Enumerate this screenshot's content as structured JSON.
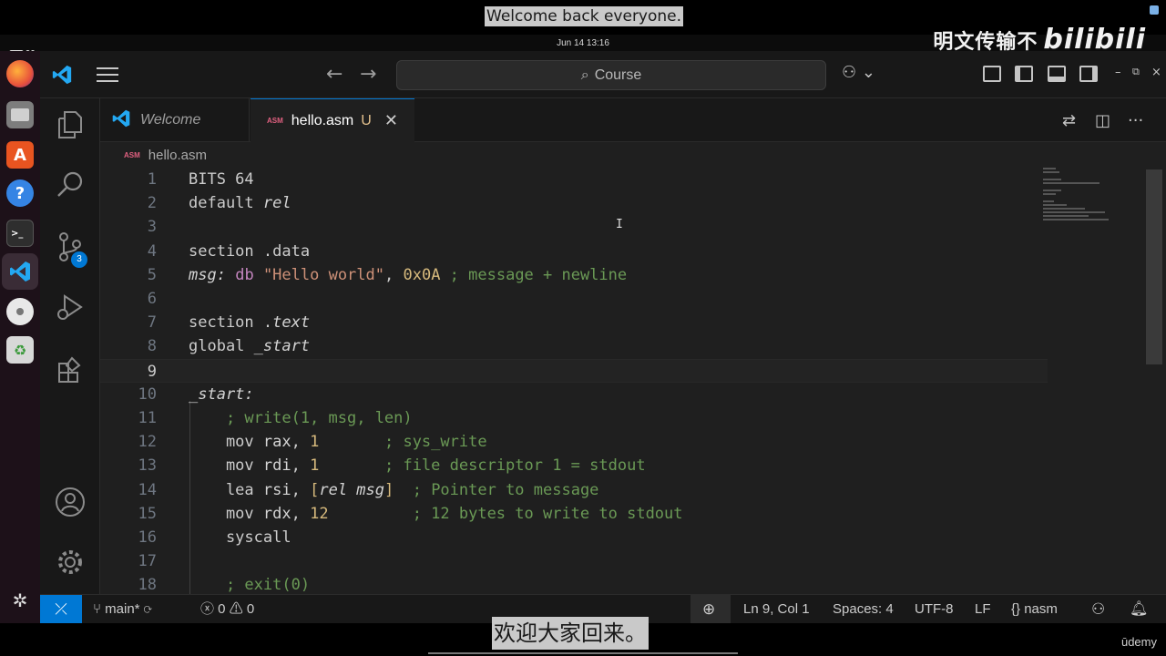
{
  "captions": {
    "top": "Welcome back everyone.",
    "bottom": "欢迎大家回来。"
  },
  "watermark": {
    "text": "明文传输不",
    "logo": "bilibili"
  },
  "system": {
    "clock": "Jun 14  13:16"
  },
  "dock": {
    "items": [
      "firefox-icon",
      "files-icon",
      "app-center-icon",
      "help-icon",
      "terminal-icon",
      "vscode-icon",
      "disc-icon",
      "trash-icon",
      "ubuntu-icon"
    ]
  },
  "titlebar": {
    "search_label": "Course",
    "search_icon": "search-icon"
  },
  "activitybar": {
    "scm_badge": "3"
  },
  "tabs": [
    {
      "label": "Welcome",
      "active": false
    },
    {
      "label": "hello.asm",
      "active": true,
      "status": "U",
      "icon": "ASM"
    }
  ],
  "breadcrumb": {
    "file": "hello.asm",
    "icon": "ASM"
  },
  "editor": {
    "line_numbers": [
      "1",
      "2",
      "3",
      "4",
      "5",
      "6",
      "7",
      "8",
      "9",
      "10",
      "11",
      "12",
      "13",
      "14",
      "15",
      "16",
      "17",
      "18"
    ],
    "current_line": 9,
    "lines": [
      [
        {
          "t": "BITS 64",
          "c": "kw"
        }
      ],
      [
        {
          "t": "default ",
          "c": "kw"
        },
        {
          "t": "rel",
          "c": "it"
        }
      ],
      [],
      [
        {
          "t": "section .data",
          "c": "kw"
        }
      ],
      [
        {
          "t": "msg:",
          "c": "it"
        },
        {
          "t": " ",
          "c": "kw"
        },
        {
          "t": "db",
          "c": "op"
        },
        {
          "t": " ",
          "c": "kw"
        },
        {
          "t": "\"Hello world\"",
          "c": "str"
        },
        {
          "t": ", ",
          "c": "kw"
        },
        {
          "t": "0x0A",
          "c": "num"
        },
        {
          "t": " ; message + newline",
          "c": "cm"
        }
      ],
      [],
      [
        {
          "t": "section .",
          "c": "kw"
        },
        {
          "t": "text",
          "c": "it"
        }
      ],
      [
        {
          "t": "global ",
          "c": "kw"
        },
        {
          "t": "_start",
          "c": "it"
        }
      ],
      [],
      [
        {
          "t": "_start:",
          "c": "it"
        }
      ],
      [
        {
          "t": "    ; write(1, msg, len)",
          "c": "cm"
        }
      ],
      [
        {
          "t": "    mov ",
          "c": "kw"
        },
        {
          "t": "rax",
          "c": "reg"
        },
        {
          "t": ", ",
          "c": "kw"
        },
        {
          "t": "1",
          "c": "num"
        },
        {
          "t": "       ; sys_write",
          "c": "cm"
        }
      ],
      [
        {
          "t": "    mov ",
          "c": "kw"
        },
        {
          "t": "rdi",
          "c": "reg"
        },
        {
          "t": ", ",
          "c": "kw"
        },
        {
          "t": "1",
          "c": "num"
        },
        {
          "t": "       ; file descriptor 1 = stdout",
          "c": "cm"
        }
      ],
      [
        {
          "t": "    lea ",
          "c": "kw"
        },
        {
          "t": "rsi",
          "c": "reg"
        },
        {
          "t": ", ",
          "c": "kw"
        },
        {
          "t": "[",
          "c": "br"
        },
        {
          "t": "rel msg",
          "c": "it"
        },
        {
          "t": "]",
          "c": "br"
        },
        {
          "t": "  ; Pointer to message",
          "c": "cm"
        }
      ],
      [
        {
          "t": "    mov ",
          "c": "kw"
        },
        {
          "t": "rdx",
          "c": "reg"
        },
        {
          "t": ", ",
          "c": "kw"
        },
        {
          "t": "12",
          "c": "num"
        },
        {
          "t": "         ; 12 bytes to write to stdout",
          "c": "cm"
        }
      ],
      [
        {
          "t": "    syscall",
          "c": "kw"
        }
      ],
      [],
      [
        {
          "t": "    ; exit(0)",
          "c": "cm"
        }
      ]
    ]
  },
  "statusbar": {
    "branch": "main*",
    "errors": "0",
    "warnings": "0",
    "position": "Ln 9, Col 1",
    "spaces": "Spaces: 4",
    "encoding": "UTF-8",
    "eol": "LF",
    "language": "nasm"
  },
  "branding": {
    "udemy": "ūdemy"
  }
}
